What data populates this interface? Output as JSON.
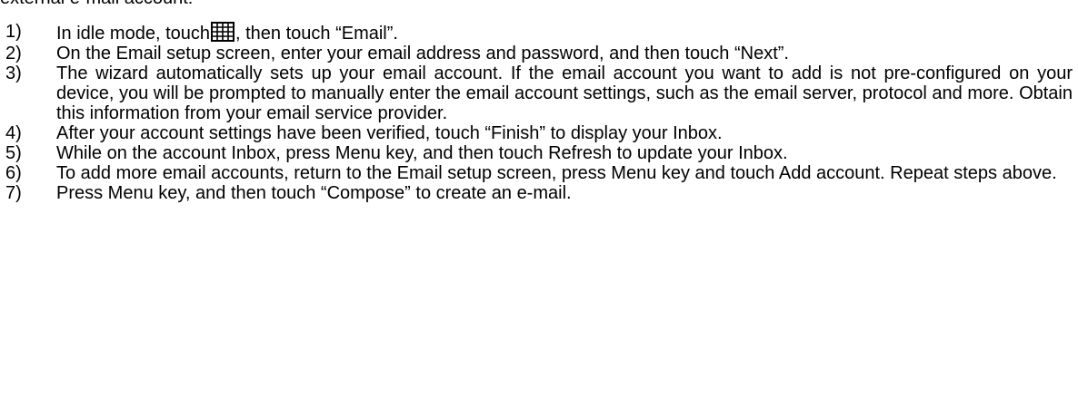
{
  "intro": {
    "text": "external e-mail account:"
  },
  "icons": {
    "menu_grid": "grid-icon"
  },
  "steps": [
    {
      "num": "1)",
      "text_before_icon": "In idle mode, touch",
      "text_after_icon": ", then touch “Email”."
    },
    {
      "num": "2)",
      "text": "On the Email setup screen, enter your email address and password, and then touch “Next”."
    },
    {
      "num": "3)",
      "text": "The wizard automatically sets up your email account. If the email account you want to add is not pre-configured on your device, you will be prompted to manually enter the email account settings, such as the email server, protocol and more. Obtain this information from your email service provider."
    },
    {
      "num": "4)",
      "text": "After your account settings have been verified, touch “Finish” to display your Inbox."
    },
    {
      "num": "5)",
      "text": "While on the account Inbox, press Menu key, and then touch Refresh to update your Inbox."
    },
    {
      "num": "6)",
      "text": "To add more email accounts, return to the Email setup screen, press Menu key and touch Add account. Repeat steps above."
    },
    {
      "num": "7)",
      "text": "Press Menu key, and then touch “Compose” to create an e-mail."
    }
  ]
}
